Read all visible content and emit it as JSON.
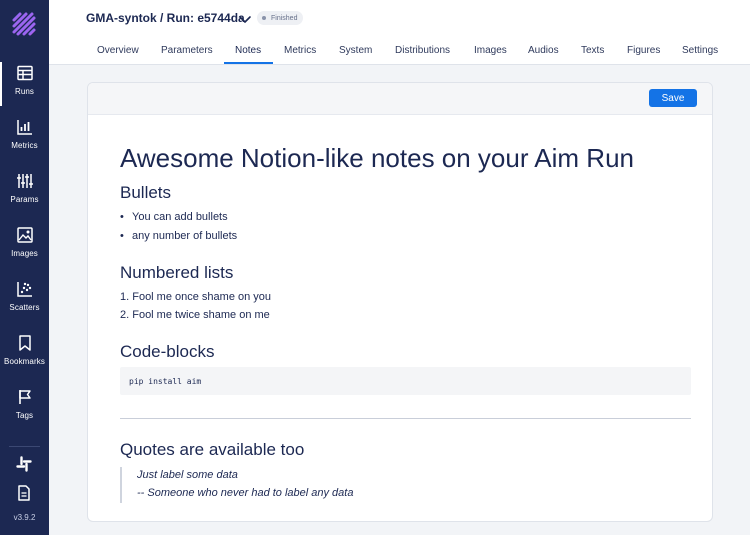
{
  "app": {
    "version": "v3.9.2"
  },
  "sidebar": {
    "items": [
      {
        "label": "Runs",
        "icon": "table-icon"
      },
      {
        "label": "Metrics",
        "icon": "metrics-chart-icon"
      },
      {
        "label": "Params",
        "icon": "params-sliders-icon"
      },
      {
        "label": "Images",
        "icon": "image-icon"
      },
      {
        "label": "Scatters",
        "icon": "scatter-icon"
      },
      {
        "label": "Bookmarks",
        "icon": "bookmark-icon"
      },
      {
        "label": "Tags",
        "icon": "flag-icon"
      }
    ],
    "active": "Runs"
  },
  "header": {
    "title": "GMA-syntok / Run: e5744da",
    "status": "Finished"
  },
  "tabs": [
    "Overview",
    "Parameters",
    "Notes",
    "Metrics",
    "System",
    "Distributions",
    "Images",
    "Audios",
    "Texts",
    "Figures",
    "Settings"
  ],
  "active_tab": "Notes",
  "notes": {
    "save_label": "Save",
    "title": "Awesome Notion-like notes on your Aim Run",
    "bullets_heading": "Bullets",
    "bullets": [
      "You can add bullets",
      "any number of bullets"
    ],
    "numbered_heading": "Numbered lists",
    "numbered": [
      "1. Fool me once shame on you",
      "2. Fool me twice shame on me"
    ],
    "code_heading": "Code-blocks",
    "code": "pip install aim",
    "quotes_heading": "Quotes are available too",
    "quote_lines": [
      "Just label some data",
      "-- Someone who never had to label any data"
    ]
  },
  "colors": {
    "sidebar_bg": "#1c2852",
    "accent": "#1473e6",
    "text": "#1c2852"
  }
}
